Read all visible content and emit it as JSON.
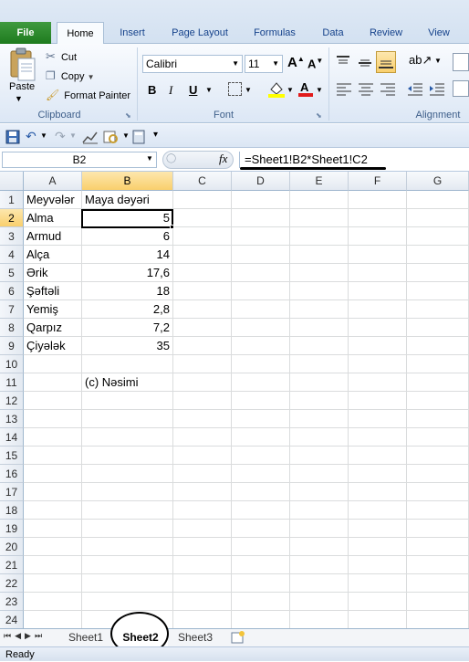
{
  "ribbon": {
    "tabs": [
      "File",
      "Home",
      "Insert",
      "Page Layout",
      "Formulas",
      "Data",
      "Review",
      "View"
    ],
    "active_tab": "Home",
    "clipboard": {
      "paste": "Paste",
      "cut": "Cut",
      "copy": "Copy",
      "format_painter": "Format Painter",
      "group": "Clipboard"
    },
    "font": {
      "name": "Calibri",
      "size": "11",
      "group": "Font"
    },
    "alignment": {
      "group": "Alignment"
    }
  },
  "formula_bar": {
    "name_box": "B2",
    "fx": "fx",
    "formula": "=Sheet1!B2*Sheet1!C2"
  },
  "sheet": {
    "columns": [
      "A",
      "B",
      "C",
      "D",
      "E",
      "F",
      "G"
    ],
    "rows": [
      "1",
      "2",
      "3",
      "4",
      "5",
      "6",
      "7",
      "8",
      "9",
      "10",
      "11",
      "12",
      "13",
      "14",
      "15",
      "16",
      "17",
      "18",
      "19",
      "20",
      "21",
      "22",
      "23",
      "24"
    ],
    "header_row": {
      "a": "Meyvələr",
      "b": "Maya dəyəri"
    },
    "data": [
      {
        "a": "Alma",
        "b": "5"
      },
      {
        "a": "Armud",
        "b": "6"
      },
      {
        "a": "Alça",
        "b": "14"
      },
      {
        "a": "Ərik",
        "b": "17,6"
      },
      {
        "a": "Şəftəli",
        "b": "18"
      },
      {
        "a": "Yemiş",
        "b": "2,8"
      },
      {
        "a": "Qarpız",
        "b": "7,2"
      },
      {
        "a": "Çiyələk",
        "b": "35"
      }
    ],
    "note": "(c) Nəsimi"
  },
  "sheet_tabs": [
    "Sheet1",
    "Sheet2",
    "Sheet3"
  ],
  "active_sheet": "Sheet2",
  "status": "Ready",
  "colors": {
    "file_tab": "#1e7b1e",
    "ribbon_text": "#15428b",
    "selection": "#f9cf6c"
  }
}
